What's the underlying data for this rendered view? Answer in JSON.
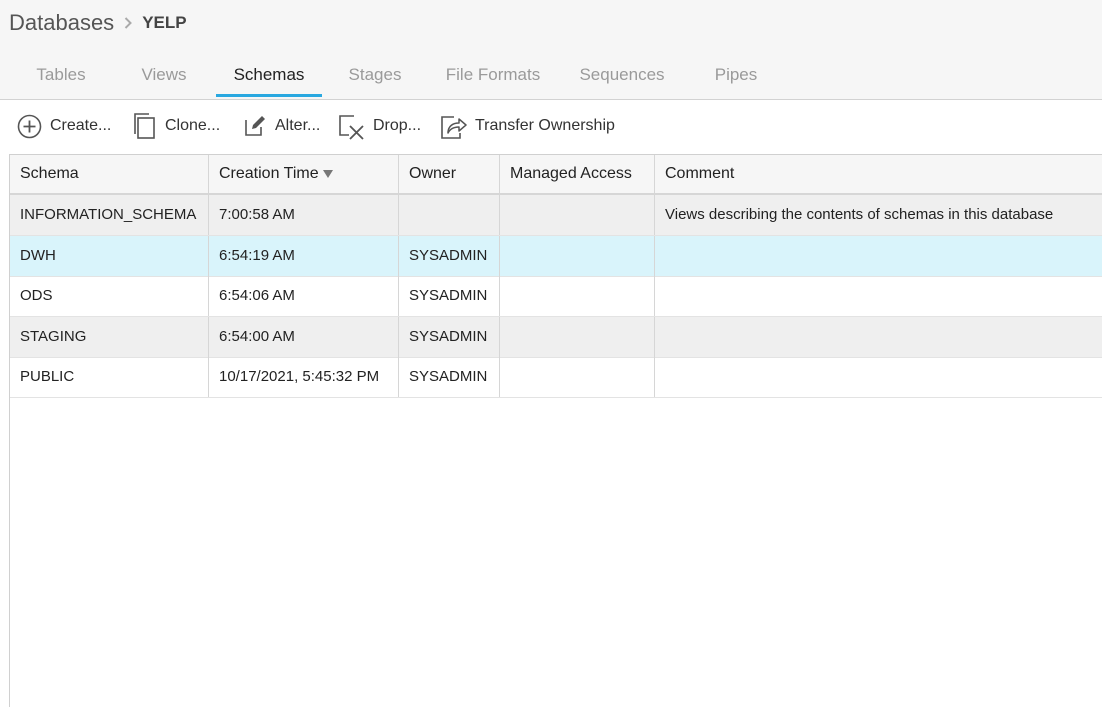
{
  "breadcrumb": {
    "root": "Databases",
    "current": "YELP"
  },
  "tabs": [
    "Tables",
    "Views",
    "Schemas",
    "Stages",
    "File Formats",
    "Sequences",
    "Pipes"
  ],
  "active_tab": "Schemas",
  "toolbar": {
    "create": "Create...",
    "clone": "Clone...",
    "alter": "Alter...",
    "drop": "Drop...",
    "transfer": "Transfer Ownership"
  },
  "table": {
    "columns": [
      "Schema",
      "Creation Time",
      "Owner",
      "Managed Access",
      "Comment"
    ],
    "sorted_column": "Creation Time",
    "rows": [
      [
        "INFORMATION_SCHEMA",
        "7:00:58 AM",
        "",
        "",
        "Views describing the contents of schemas in this database"
      ],
      [
        "DWH",
        "6:54:19 AM",
        "SYSADMIN",
        "",
        ""
      ],
      [
        "ODS",
        "6:54:06 AM",
        "SYSADMIN",
        "",
        ""
      ],
      [
        "STAGING",
        "6:54:00 AM",
        "SYSADMIN",
        "",
        ""
      ],
      [
        "PUBLIC",
        "10/17/2021, 5:45:32 PM",
        "SYSADMIN",
        "",
        ""
      ]
    ],
    "selected_row": 1
  },
  "colors": {
    "accent": "#29a8e0",
    "selected_row": "#d9f4fb",
    "header_bg": "#f6f6f6"
  }
}
